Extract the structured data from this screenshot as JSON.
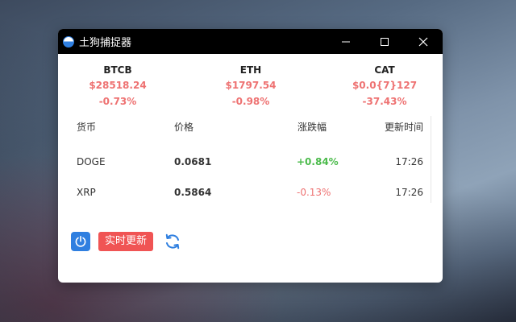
{
  "window": {
    "title": "土狗捕捉器"
  },
  "tickers": [
    {
      "symbol": "BTCB",
      "price": "$28518.24",
      "change": "-0.73%"
    },
    {
      "symbol": "ETH",
      "price": "$1797.54",
      "change": "-0.98%"
    },
    {
      "symbol": "CAT",
      "price": "$0.0{7}127",
      "change": "-37.43%"
    }
  ],
  "table": {
    "headers": {
      "coin": "货币",
      "price": "价格",
      "change": "涨跌幅",
      "time": "更新时间"
    },
    "rows": [
      {
        "coin": "DOGE",
        "price": "0.0681",
        "change": "+0.84%",
        "time": "17:26"
      },
      {
        "coin": "XRP",
        "price": "0.5864",
        "change": "-0.13%",
        "time": "17:26"
      }
    ]
  },
  "actions": {
    "power_icon": "power-icon",
    "live_label": "实时更新",
    "refresh_icon": "refresh-icon"
  },
  "colors": {
    "up": "#4cbb4c",
    "down": "#ee7272",
    "accent": "#2f7fe0",
    "live": "#f05454"
  }
}
